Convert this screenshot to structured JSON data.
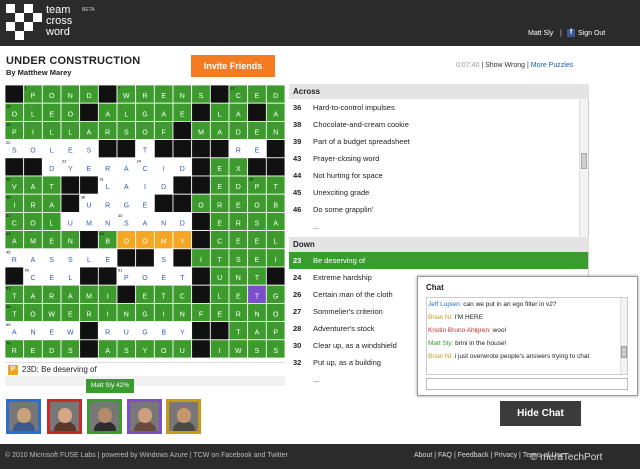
{
  "header": {
    "logo_text": "team\ncross\nword",
    "beta": "BETA",
    "username": "Matt Sly",
    "separator": "|",
    "facebook_badge": "f",
    "signout": "Sign Out"
  },
  "puzzle": {
    "title": "UNDER CONSTRUCTION",
    "author": "By Matthew Marey",
    "invite_label": "Invite Friends",
    "timer": "0:07:40",
    "show_wrong": "Show Wrong",
    "more_puzzles": "More Puzzles",
    "sep": "|"
  },
  "grid": {
    "size": 15,
    "rows": [
      "#POND#WRENS#CED",
      "OLEO#ALGAE#LA#A",
      "PILLARSOF#MADEN",
      "SOLES##T####RE#",
      "##DYERACID#EX##",
      "VAT##LAID##EDPT",
      "IRA#URGE##OREOB",
      "COLUMNSAND#ERSA",
      "AMEN#BOOMY#CEEL",
      "RASSLE##S#ITSEI",
      "#CEL##POET#UNT#",
      "TARAMI#ETC#LETGO",
      "TOWERINGINFERNO",
      "ANEW#RUGBY##TAP",
      "REDS#ASYOU#IWSS"
    ],
    "numbers": {
      "0,1": "1",
      "0,6": "7",
      "0,12": "13",
      "1,0": "16",
      "2,0": "19",
      "3,0": "20",
      "4,3": "22",
      "4,7": "24",
      "5,0": "29",
      "5,5": "31",
      "5,13": "35",
      "6,0": "36",
      "6,4": "38",
      "7,0": "41",
      "7,6": "40",
      "8,0": "43",
      "8,5": "44",
      "9,0": "45",
      "10,1": "50",
      "10,6": "51",
      "11,0": "53",
      "12,0": "56",
      "13,0": "65",
      "13,10": "67",
      "14,0": "70"
    },
    "colors": {
      "green": "#3d9b2e",
      "black": "#111111",
      "white": "#ffffff",
      "orange_highlight": "#f5a623",
      "gold": "#c5a028",
      "red": "#d22020",
      "blue": "#1d4fd0",
      "purple": "#7b4fc9"
    }
  },
  "current_clue": {
    "icon": "P",
    "text": "23D: Be deserving of"
  },
  "across": {
    "header": "Across",
    "clues": [
      {
        "num": "36",
        "text": "Hard-to-control impulses"
      },
      {
        "num": "38",
        "text": "Chocolate-and-cream cookie"
      },
      {
        "num": "39",
        "text": "Part of a budget spreadsheet"
      },
      {
        "num": "43",
        "text": "Prayer-closing word"
      },
      {
        "num": "44",
        "text": "Not hurting for space"
      },
      {
        "num": "45",
        "text": "Unexciting grade"
      },
      {
        "num": "46",
        "text": "Do some grapplin'"
      },
      {
        "num": "",
        "text": "..."
      }
    ]
  },
  "down": {
    "header": "Down",
    "clues": [
      {
        "num": "23",
        "text": "Be deserving of",
        "active": true
      },
      {
        "num": "24",
        "text": "Extreme hardship"
      },
      {
        "num": "26",
        "text": "Certain man of the cloth"
      },
      {
        "num": "27",
        "text": "Sommelier's criterion"
      },
      {
        "num": "28",
        "text": "Adventurer's stock"
      },
      {
        "num": "30",
        "text": "Clear up, as a windshield"
      },
      {
        "num": "32",
        "text": "Put up, as a building"
      },
      {
        "num": "",
        "text": "..."
      }
    ]
  },
  "chat": {
    "title": "Chat",
    "messages": [
      {
        "user": "Jeff Lupien:",
        "text": " can we put in an ego filter in v2?",
        "color": "#2a6fcf"
      },
      {
        "user": "Brian Ni:",
        "text": " I'M HERE",
        "color": "#c89a1a"
      },
      {
        "user": "Kristin Bruno Ahlgren:",
        "text": " woo!",
        "color": "#cc2a2a"
      },
      {
        "user": "Matt Sly:",
        "text": " brini in the house!",
        "color": "#3a9b2f"
      },
      {
        "user": "Brian Ni:",
        "text": " i just overwrote people's answers trying to chat",
        "color": "#c89a1a"
      }
    ],
    "input_placeholder": ""
  },
  "presence": {
    "bubble": "Matt Sly 42%",
    "avatars": [
      {
        "border": "#2a6fcf",
        "face": "#caa27c",
        "body": "#3b5a8a"
      },
      {
        "border": "#cc2a2a",
        "face": "#d7a785",
        "body": "#5a3a2a"
      },
      {
        "border": "#3a9b2f",
        "face": "#b58a6a",
        "body": "#2d2d2d"
      },
      {
        "border": "#7b4fc9",
        "face": "#caa07f",
        "body": "#6a4a3a"
      },
      {
        "border": "#c89a1a",
        "face": "#c6966e",
        "body": "#4a4a4a"
      }
    ]
  },
  "hide_chat_label": "Hide Chat",
  "footer": {
    "copyright": "© 2010 Microsoft FUSE Labs",
    "powered": "| powered by Windows Azure",
    "tcw": "| TCW on Facebook and Twitter",
    "links": "About | FAQ | Feedback | Privacy | Terms of Use",
    "watermark": "© meraTechPort"
  }
}
